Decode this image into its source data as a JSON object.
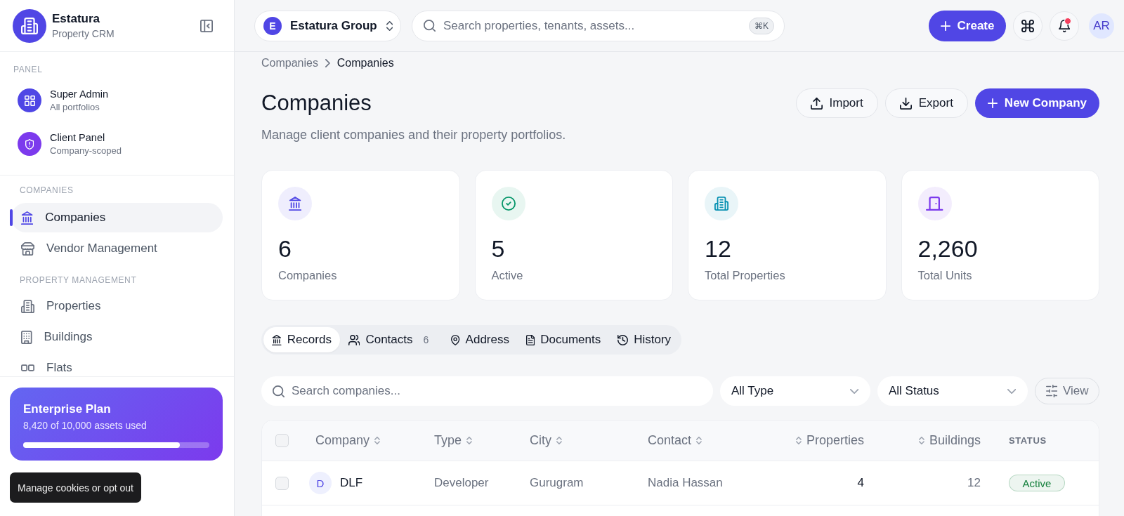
{
  "sidebar": {
    "brand": {
      "name": "Estatura",
      "subtitle": "Property CRM"
    },
    "panel_label": "PANEL",
    "panels": [
      {
        "title": "Super Admin",
        "subtitle": "All portfolios",
        "color": "#4f46e5"
      },
      {
        "title": "Client Panel",
        "subtitle": "Company-scoped",
        "color": "#7c3aed"
      }
    ],
    "sections": [
      {
        "label": "COMPANIES",
        "items": [
          {
            "label": "Companies",
            "selected": true
          },
          {
            "label": "Vendor Management",
            "selected": false
          }
        ]
      },
      {
        "label": "PROPERTY MANAGEMENT",
        "items": [
          {
            "label": "Properties",
            "selected": false
          },
          {
            "label": "Buildings",
            "selected": false
          },
          {
            "label": "Flats",
            "selected": false
          }
        ]
      }
    ],
    "plan": {
      "title": "Enterprise Plan",
      "usage": "8,420 of 10,000 assets used",
      "level": 0.842
    },
    "cookie_button": "Manage cookies or opt out"
  },
  "topbar": {
    "org": {
      "initial": "E",
      "name": "Estatura Group"
    },
    "search": {
      "placeholder": "Search properties, tenants, assets...",
      "shortcut": "⌘K"
    },
    "create_button": "Create",
    "notifications": {
      "unread": true
    },
    "avatar": "AR"
  },
  "breadcrumb": [
    "Companies",
    "Companies"
  ],
  "page": {
    "title": "Companies",
    "subtitle": "Manage client companies and their property portfolios.",
    "actions": [
      {
        "label": "Import",
        "kind": "outline"
      },
      {
        "label": "Export",
        "kind": "outline"
      },
      {
        "label": "New Company",
        "kind": "primary"
      }
    ]
  },
  "stats": [
    {
      "value": "6",
      "label": "Companies",
      "color": "#4f46e5"
    },
    {
      "value": "5",
      "label": "Active",
      "color": "#059669"
    },
    {
      "value": "12",
      "label": "Total Properties",
      "color": "#0891b2"
    },
    {
      "value": "2,260",
      "label": "Total Units",
      "color": "#7c3aed"
    }
  ],
  "tabs": [
    {
      "label": "Records",
      "selected": true
    },
    {
      "label": "Contacts",
      "count": "6",
      "selected": false
    },
    {
      "label": "Address",
      "selected": false
    },
    {
      "label": "Documents",
      "selected": false
    },
    {
      "label": "History",
      "selected": false
    }
  ],
  "filters": {
    "search_placeholder": "Search companies...",
    "selects": [
      "All Type",
      "All Status"
    ],
    "view_button": "View"
  },
  "table": {
    "select_all": {
      "checked": false
    },
    "columns": [
      {
        "label": "Company",
        "kind": "text",
        "sortable": true
      },
      {
        "label": "Type",
        "kind": "text",
        "sortable": true
      },
      {
        "label": "City",
        "kind": "text",
        "sortable": true
      },
      {
        "label": "Contact",
        "kind": "text",
        "sortable": true
      },
      {
        "label": "Properties",
        "kind": "number",
        "sortable": true
      },
      {
        "label": "Buildings",
        "kind": "number",
        "sortable": true
      },
      {
        "label": "STATUS",
        "kind": "status",
        "sortable": false
      }
    ],
    "rows": [
      {
        "checked": false,
        "initial": "D",
        "company": "DLF",
        "type": "Developer",
        "city": "Gurugram",
        "contact": "Nadia Hassan",
        "properties": "4",
        "buildings": "12",
        "status": {
          "label": "Active",
          "color": "#15803d"
        }
      }
    ]
  }
}
